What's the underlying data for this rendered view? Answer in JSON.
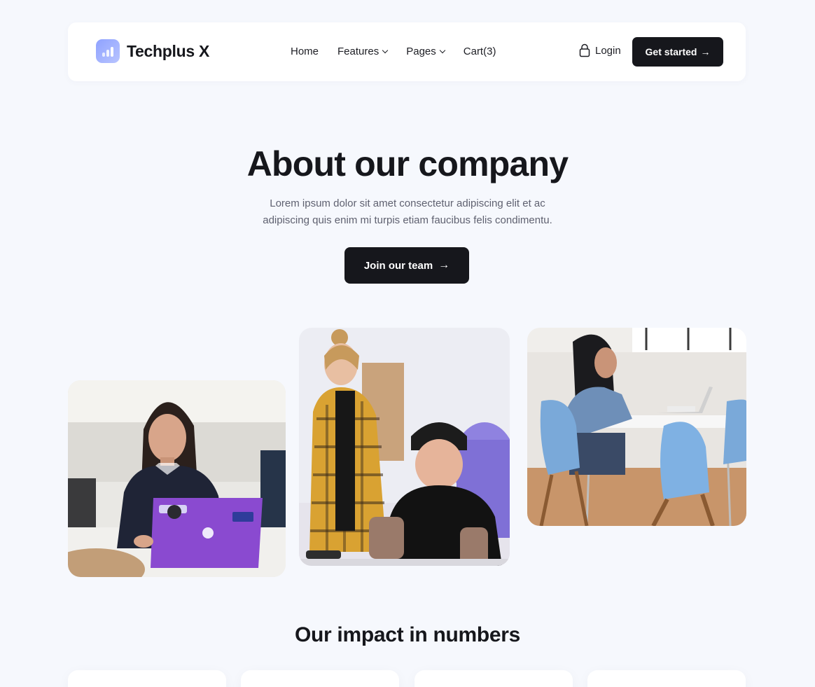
{
  "brand": {
    "name": "Techplus X",
    "logo_icon": "bar-chart-icon",
    "accent": "#9aabff"
  },
  "nav": {
    "items": [
      {
        "label": "Home",
        "has_dropdown": false
      },
      {
        "label": "Features",
        "has_dropdown": true
      },
      {
        "label": "Pages",
        "has_dropdown": true
      },
      {
        "label": "Cart(3)",
        "has_dropdown": false
      }
    ],
    "login_label": "Login",
    "login_icon": "lock-icon",
    "cta_label": "Get started",
    "cta_arrow": "→"
  },
  "hero": {
    "title": "About our company",
    "subtitle": "Lorem ipsum dolor sit amet consectetur adipiscing elit et ac adipiscing quis enim mi turpis etiam faucibus felis condimentu.",
    "button_label": "Join our team",
    "button_arrow": "→"
  },
  "photos": [
    {
      "subject": "woman-with-laptop-photo"
    },
    {
      "subject": "two-coworkers-photo"
    },
    {
      "subject": "woman-at-desk-photo"
    }
  ],
  "impact": {
    "title": "Our impact in numbers"
  },
  "colors": {
    "background": "#f6f8fd",
    "dark": "#16171c",
    "muted_text": "#5f6170"
  }
}
